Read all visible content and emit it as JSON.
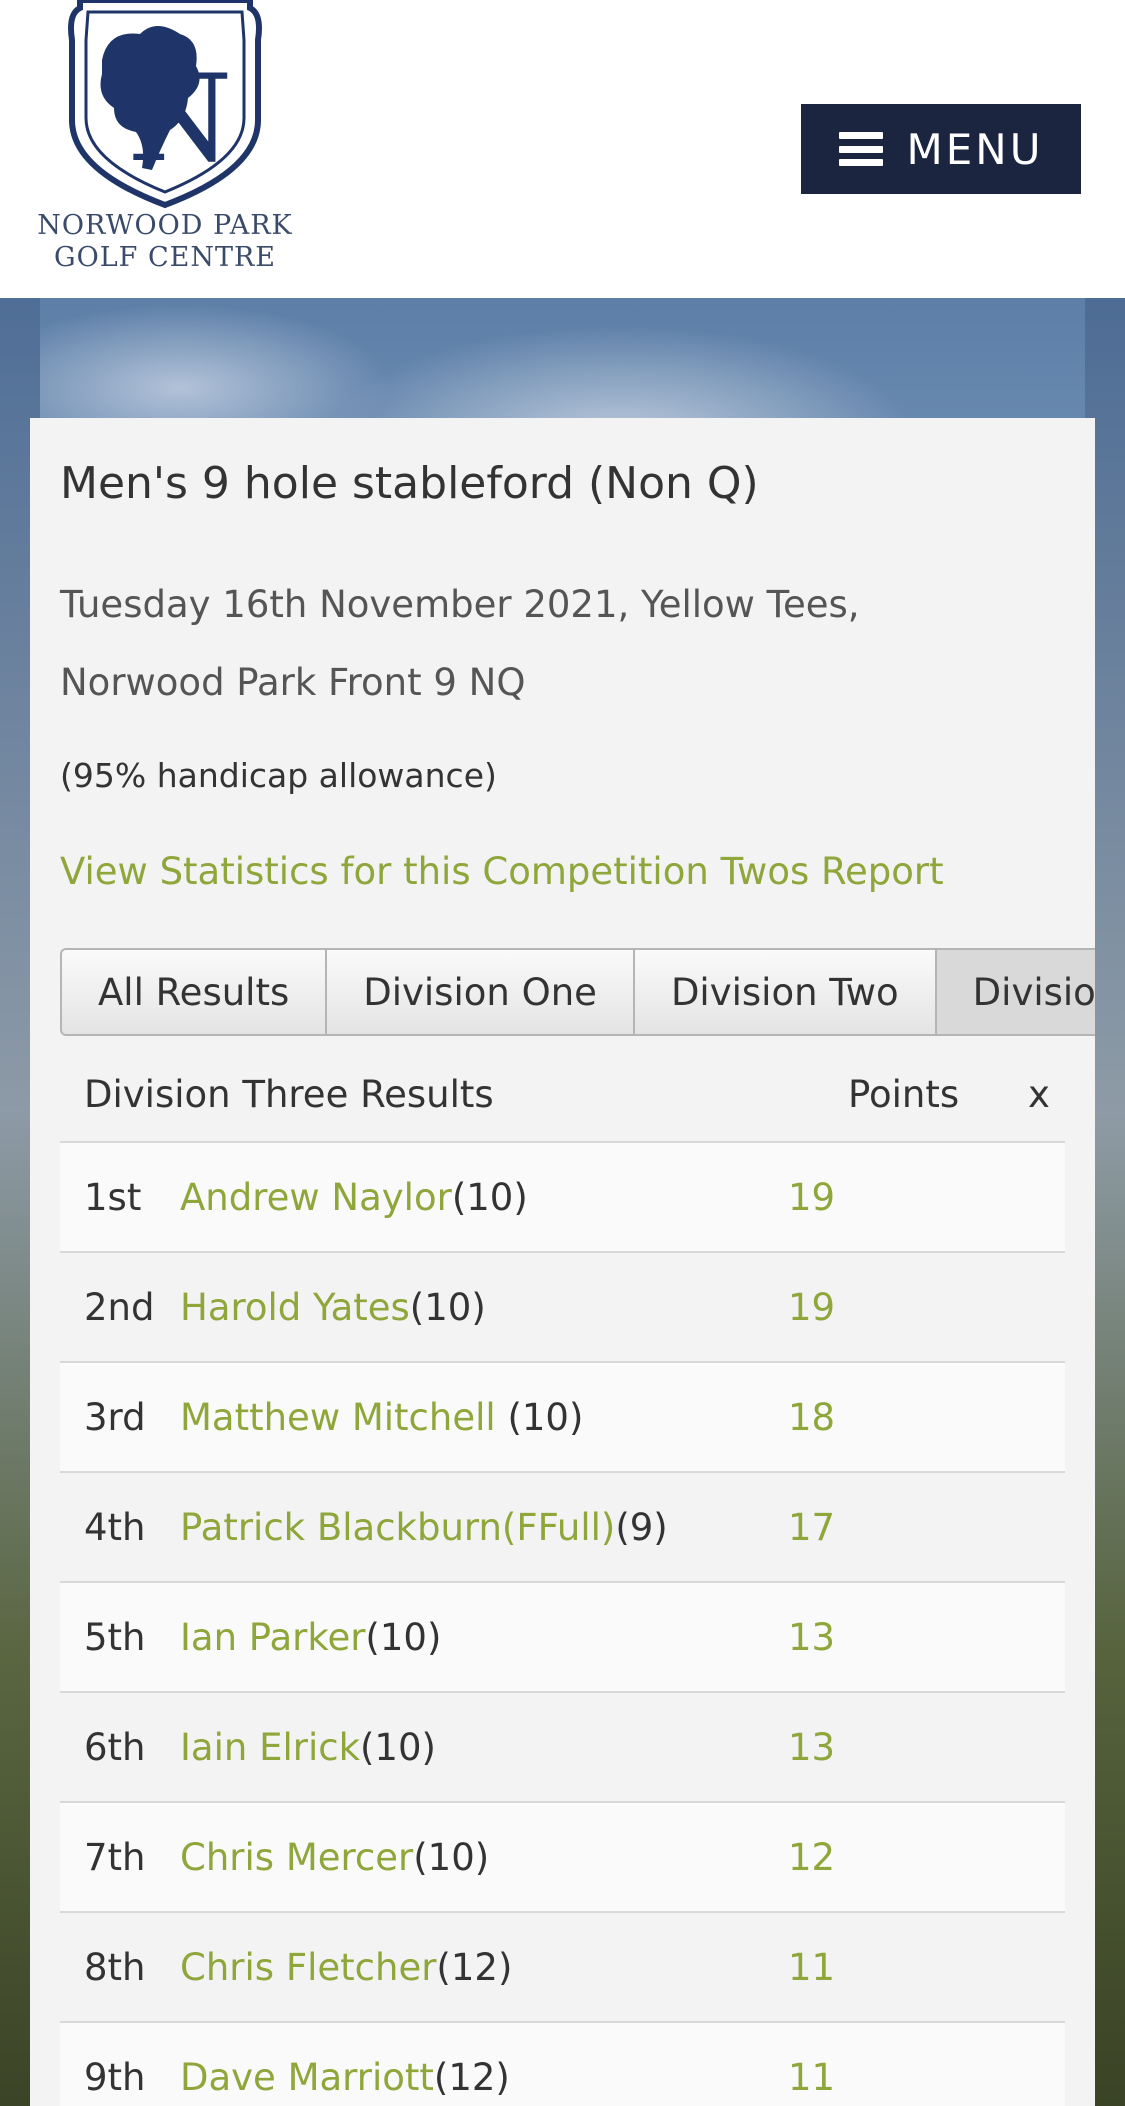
{
  "logo": {
    "line1": "NORWOOD PARK",
    "line2": "GOLF CENTRE"
  },
  "header": {
    "menu_label": "MENU"
  },
  "competition": {
    "title": "Men's 9 hole stableford (Non Q)",
    "details": "Tuesday 16th November 2021, Yellow Tees, Norwood Park Front 9 NQ",
    "allowance": "(95% handicap allowance)",
    "stats_link": "View Statistics for this Competition",
    "twos_link": "Twos Report"
  },
  "tabs": [
    {
      "label": "All Results"
    },
    {
      "label": "Division One"
    },
    {
      "label": "Division Two"
    },
    {
      "label": "Division Three"
    }
  ],
  "results": {
    "heading": "Division Three Results",
    "points_header": "Points",
    "x_header": "x",
    "rows": [
      {
        "pos": "1st",
        "name": "Andrew Naylor",
        "hcap": "(10)",
        "points": "19"
      },
      {
        "pos": "2nd",
        "name": "Harold Yates",
        "hcap": "(10)",
        "points": "19"
      },
      {
        "pos": "3rd",
        "name": "Matthew Mitchell ",
        "hcap": "(10)",
        "points": "18"
      },
      {
        "pos": "4th",
        "name": "Patrick Blackburn(FFull)",
        "hcap": "(9)",
        "points": "17"
      },
      {
        "pos": "5th",
        "name": "Ian Parker",
        "hcap": "(10)",
        "points": "13"
      },
      {
        "pos": "6th",
        "name": "Iain Elrick",
        "hcap": "(10)",
        "points": "13"
      },
      {
        "pos": "7th",
        "name": "Chris Mercer",
        "hcap": "(10)",
        "points": "12"
      },
      {
        "pos": "8th",
        "name": "Chris Fletcher",
        "hcap": "(12)",
        "points": "11"
      },
      {
        "pos": "9th",
        "name": "Dave Marriott",
        "hcap": "(12)",
        "points": "11"
      }
    ]
  },
  "colors": {
    "link_green": "#8ea63a",
    "menu_navy": "#1b2540",
    "logo_navy": "#1f3468"
  }
}
